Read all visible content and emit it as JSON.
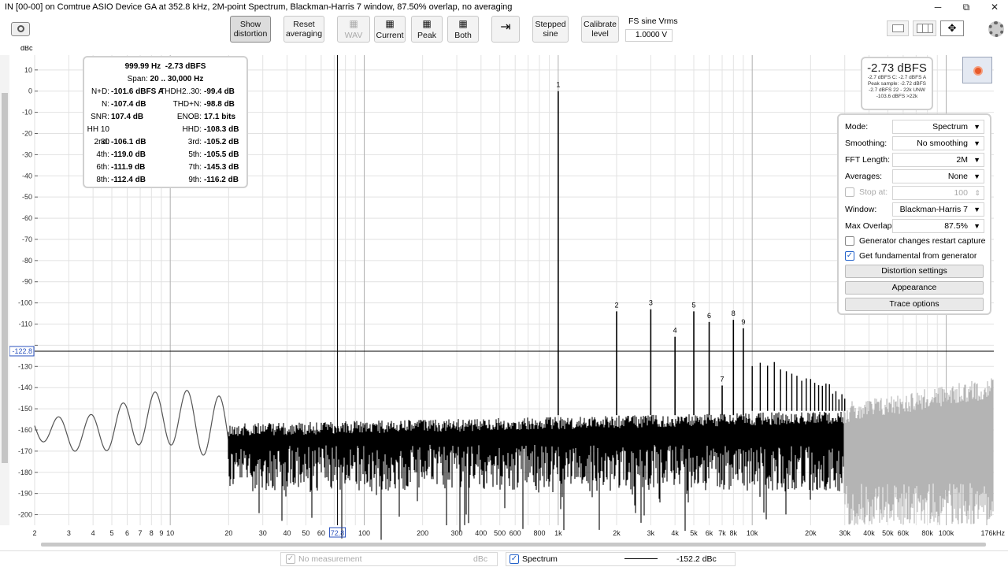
{
  "window": {
    "title": "IN [00-00] on Comtrue ASIO Device GA at 352.8 kHz, 2M-point Spectrum, Blackman-Harris 7 window, 87.50% overlap, no averaging",
    "minimize": "─",
    "maximize": "⧉",
    "close": "✕"
  },
  "toolbar": {
    "show_distortion": [
      "Show",
      "distortion"
    ],
    "reset_averaging": [
      "Reset",
      "averaging"
    ],
    "wav": "WAV",
    "current": "Current",
    "peak": "Peak",
    "both": "Both",
    "stepped_sine": [
      "Stepped",
      "sine"
    ],
    "calibrate_level": [
      "Calibrate",
      "level"
    ],
    "fs_sine_label": "FS sine Vrms",
    "fs_sine_value": "1.0000 V"
  },
  "plot": {
    "y_unit": "dBc",
    "y_ticks": [
      "10",
      "0",
      "-10",
      "-20",
      "-30",
      "-40",
      "-50",
      "-60",
      "-70",
      "-80",
      "-90",
      "-100",
      "-110",
      "-120",
      "-130",
      "-140",
      "-150",
      "-160",
      "-170",
      "-180",
      "-190",
      "-200"
    ],
    "x_ticks": [
      "2",
      "3",
      "4",
      "5",
      "6",
      "7",
      "8",
      "9",
      "10",
      "20",
      "30",
      "40",
      "50",
      "60",
      "72.8",
      "100",
      "200",
      "300",
      "400",
      "500",
      "600",
      "800",
      "1k",
      "2k",
      "3k",
      "4k",
      "5k",
      "6k",
      "7k",
      "8k",
      "10k",
      "20k",
      "30k",
      "40k",
      "50k",
      "60k",
      "80k",
      "100k",
      "176kHz"
    ],
    "cursor_y_value": "-122.8",
    "cursor_x_value": "72.8",
    "harmonic_labels": [
      "1",
      "2",
      "3",
      "4",
      "5",
      "6",
      "7",
      "8",
      "9"
    ]
  },
  "chart_data": {
    "type": "line",
    "title": "",
    "xlabel": "",
    "ylabel": "dBc",
    "x_scale": "log",
    "xlim": [
      2,
      176000
    ],
    "ylim": [
      -205,
      17
    ],
    "harmonics": {
      "x": [
        1000,
        2000,
        3000,
        4000,
        5000,
        6000,
        7000,
        8000,
        9000
      ],
      "values": [
        0,
        -104,
        -103,
        -116,
        -104,
        -109,
        -139,
        -108,
        -112
      ],
      "labels": [
        "1",
        "2",
        "3",
        "4",
        "5",
        "6",
        "7",
        "8",
        "9"
      ]
    },
    "noise_floor_dbc": -155,
    "grid": true
  },
  "info": {
    "freq": "999.99 Hz",
    "level": "-2.73 dBFS",
    "span_label": "Span:",
    "span_value": "20 .. 30,000 Hz",
    "rows": [
      {
        "l1": "N+D:",
        "v1": "-101.6 dBFS A",
        "l2": "THDH2..30:",
        "v2": "-99.4 dB"
      },
      {
        "l1": "N:",
        "v1": "-107.4 dB",
        "l2": "THD+N:",
        "v2": "-98.8 dB"
      },
      {
        "l1": "SNR:",
        "v1": "107.4 dB",
        "l2": "ENOB:",
        "v2": "17.1 bits"
      },
      {
        "l1": "HH 10 .. 30",
        "v1": "",
        "l2": "HHD:",
        "v2": "-108.3 dB"
      },
      {
        "l1": "2nd:",
        "v1": "-106.1 dB",
        "l2": "3rd:",
        "v2": "-105.2 dB"
      },
      {
        "l1": "4th:",
        "v1": "-119.0 dB",
        "l2": "5th:",
        "v2": "-105.5 dB"
      },
      {
        "l1": "6th:",
        "v1": "-111.9 dB",
        "l2": "7th:",
        "v2": "-145.3 dB"
      },
      {
        "l1": "8th:",
        "v1": "-112.4 dB",
        "l2": "9th:",
        "v2": "-116.2 dB"
      }
    ]
  },
  "level_meter": {
    "big": "-2.73 dBFS",
    "lines": [
      "-2.7 dBFS C: -2.7 dBFS A",
      "Peak sample: -2.72 dBFS",
      "-2.7 dBFS 22 - 22k UNW",
      "-103.6 dBFS >22k"
    ]
  },
  "panel": {
    "mode_label": "Mode:",
    "mode_value": "Spectrum",
    "smoothing_label": "Smoothing:",
    "smoothing_value": "No smoothing",
    "fft_label": "FFT Length:",
    "fft_value": "2M",
    "averages_label": "Averages:",
    "averages_value": "None",
    "stop_at_label": "Stop at:",
    "stop_at_value": "100",
    "window_label": "Window:",
    "window_value": "Blackman-Harris 7",
    "overlap_label": "Max Overlap:",
    "overlap_value": "87.5%",
    "gen_restart_label": "Generator changes restart capture",
    "get_fundamental_label": "Get fundamental from generator",
    "distortion_settings": "Distortion settings",
    "appearance": "Appearance",
    "trace_options": "Trace options"
  },
  "statusbar": {
    "no_measurement": "No measurement",
    "unit": "dBc",
    "spectrum": "Spectrum",
    "value": "-152.2 dBc"
  }
}
